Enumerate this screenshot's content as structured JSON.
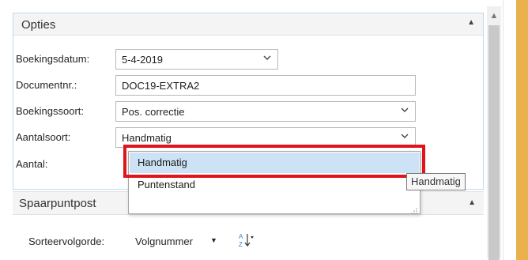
{
  "options": {
    "title": "Opties",
    "labels": {
      "boekingsdatum": "Boekingsdatum:",
      "documentnr": "Documentnr.:",
      "boekingssoort": "Boekingssoort:",
      "aantalsoort": "Aantalsoort:",
      "aantal": "Aantal:"
    },
    "values": {
      "boekingsdatum": "5-4-2019",
      "documentnr": "DOC19-EXTRA2",
      "boekingssoort": "Pos. correctie",
      "aantalsoort": "Handmatig"
    }
  },
  "dropdown": {
    "items": [
      "Handmatig",
      "Puntenstand"
    ],
    "selected": "Handmatig"
  },
  "tooltip": "Handmatig",
  "spaarpuntpost": {
    "title": "Spaarpuntpost",
    "sort_label": "Sorteervolgorde:",
    "sort_value": "Volgnummer"
  },
  "colors": {
    "highlight": "#e0141c",
    "selected_item": "#cde3f5",
    "accent_strip": "#e9b24c"
  }
}
